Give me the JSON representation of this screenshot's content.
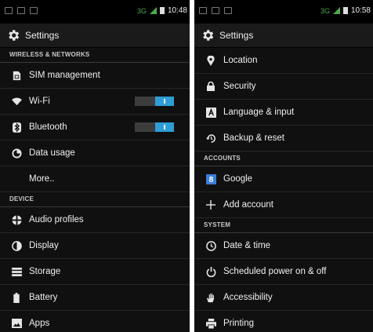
{
  "colors": {
    "background": "#101010",
    "accent": "#2f9ed6",
    "signal": "#4fa84f",
    "text": "#f0f0f0",
    "section_text": "#c9c9c9"
  },
  "left_screen": {
    "status_bar": {
      "time": "10:48",
      "network": "3G"
    },
    "action_bar": {
      "title": "Settings",
      "icon": "gear-icon"
    },
    "sections": [
      {
        "header": "WIRELESS & NETWORKS",
        "items": [
          {
            "label": "SIM management",
            "icon": "sim-icon"
          },
          {
            "label": "Wi-Fi",
            "icon": "wifi-icon",
            "toggle": "on"
          },
          {
            "label": "Bluetooth",
            "icon": "bluetooth-icon",
            "toggle": "on"
          },
          {
            "label": "Data usage",
            "icon": "data-usage-icon"
          },
          {
            "label": "More..",
            "icon": ""
          }
        ]
      },
      {
        "header": "DEVICE",
        "items": [
          {
            "label": "Audio profiles",
            "icon": "audio-profiles-icon"
          },
          {
            "label": "Display",
            "icon": "display-icon"
          },
          {
            "label": "Storage",
            "icon": "storage-icon"
          },
          {
            "label": "Battery",
            "icon": "battery-icon"
          },
          {
            "label": "Apps",
            "icon": "apps-icon"
          }
        ]
      }
    ]
  },
  "right_screen": {
    "status_bar": {
      "time": "10:58",
      "network": "3G"
    },
    "action_bar": {
      "title": "Settings",
      "icon": "gear-icon"
    },
    "top_items": [
      {
        "label": "Location",
        "icon": "location-icon"
      },
      {
        "label": "Security",
        "icon": "lock-icon"
      },
      {
        "label": "Language & input",
        "icon": "language-icon"
      },
      {
        "label": "Backup & reset",
        "icon": "backup-icon"
      }
    ],
    "accounts": {
      "header": "ACCOUNTS",
      "items": [
        {
          "label": "Google",
          "icon": "google-icon"
        },
        {
          "label": "Add account",
          "icon": "plus-icon"
        }
      ]
    },
    "system": {
      "header": "SYSTEM",
      "items": [
        {
          "label": "Date & time",
          "icon": "clock-icon"
        },
        {
          "label": "Scheduled power on & off",
          "icon": "power-icon"
        },
        {
          "label": "Accessibility",
          "icon": "hand-icon"
        },
        {
          "label": "Printing",
          "icon": "printer-icon"
        }
      ]
    }
  }
}
